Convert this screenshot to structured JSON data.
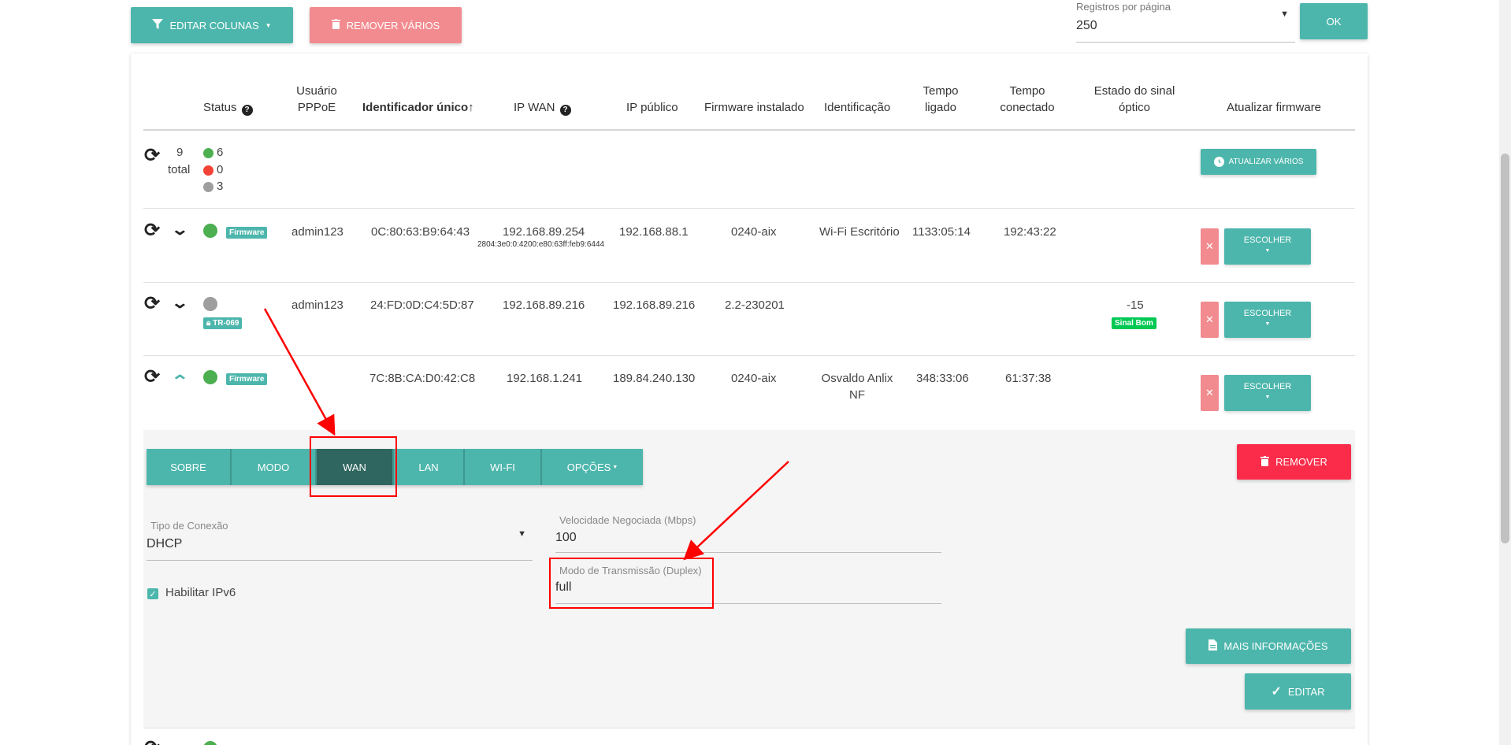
{
  "toolbar": {
    "edit_columns_label": "EDITAR COLUNAS",
    "remove_many_label": "REMOVER VÁRIOS",
    "per_page_label": "Registros por página",
    "per_page_value": "250",
    "ok_label": "OK"
  },
  "table": {
    "headers": {
      "status": "Status",
      "pppoe_user": [
        "Usuário",
        "PPPoE"
      ],
      "unique_id": "Identificador único↑",
      "ip_wan": "IP WAN",
      "public_ip": "IP público",
      "firmware": "Firmware instalado",
      "identification": "Identificação",
      "uptime": [
        "Tempo",
        "ligado"
      ],
      "connected": [
        "Tempo",
        "conectado"
      ],
      "optical": [
        "Estado do sinal",
        "óptico"
      ],
      "update_fw": "Atualizar firmware"
    },
    "summary": {
      "total_count": "9",
      "total_label": "total",
      "online": "6",
      "offline": "0",
      "unknown": "3",
      "update_many_label": "ATUALIZAR VÁRIOS"
    },
    "rows": [
      {
        "badge": "Firmware",
        "pppoe_user": "admin123",
        "unique_id": "0C:80:63:B9:64:43",
        "ip_wan": "192.168.89.254",
        "ip_wan_v6": "2804:3e0:0:4200:e80:63ff:feb9:6444",
        "public_ip": "192.168.88.1",
        "firmware": "0240-aix",
        "identification": "Wi-Fi Escritório",
        "uptime": "1133:05:14",
        "connected": "192:43:22",
        "optical": "",
        "choose_label": "ESCOLHER"
      },
      {
        "badge": "TR-069",
        "pppoe_user": "admin123",
        "unique_id": "24:FD:0D:C4:5D:87",
        "ip_wan": "192.168.89.216",
        "public_ip": "192.168.89.216",
        "firmware": "2.2-230201",
        "identification": "",
        "uptime": "",
        "connected": "",
        "optical": "-15",
        "optical_badge": "Sinal Bom",
        "choose_label": "ESCOLHER"
      },
      {
        "badge": "Firmware",
        "pppoe_user": "",
        "unique_id": "7C:8B:CA:D0:42:C8",
        "ip_wan": "192.168.1.241",
        "public_ip": "189.84.240.130",
        "firmware": "0240-aix",
        "identification": [
          "Osvaldo Anlix",
          "NF"
        ],
        "uptime": "348:33:06",
        "connected": "61:37:38",
        "optical": "",
        "choose_label": "ESCOLHER"
      }
    ]
  },
  "details": {
    "tabs": [
      "SOBRE",
      "MODO",
      "WAN",
      "LAN",
      "WI-FI",
      "OPÇÕES"
    ],
    "active_tab": "WAN",
    "remove_label": "REMOVER",
    "connection_type_label": "Tipo de Conexão",
    "connection_type_value": "DHCP",
    "speed_label": "Velocidade Negociada (Mbps)",
    "speed_value": "100",
    "duplex_label": "Modo de Transmissão (Duplex)",
    "duplex_value": "full",
    "ipv6_label": "Habilitar IPv6",
    "more_info_label": "MAIS INFORMAÇÕES",
    "edit_label": "EDITAR"
  },
  "colors": {
    "teal": "#4db6ac",
    "teal_active": "#2f665f",
    "danger": "#fb2c4a",
    "danger_light": "#f28b8f",
    "online": "#4caf50",
    "offline": "#f44336",
    "unknown": "#9e9e9e",
    "annotation": "#ff0000"
  }
}
